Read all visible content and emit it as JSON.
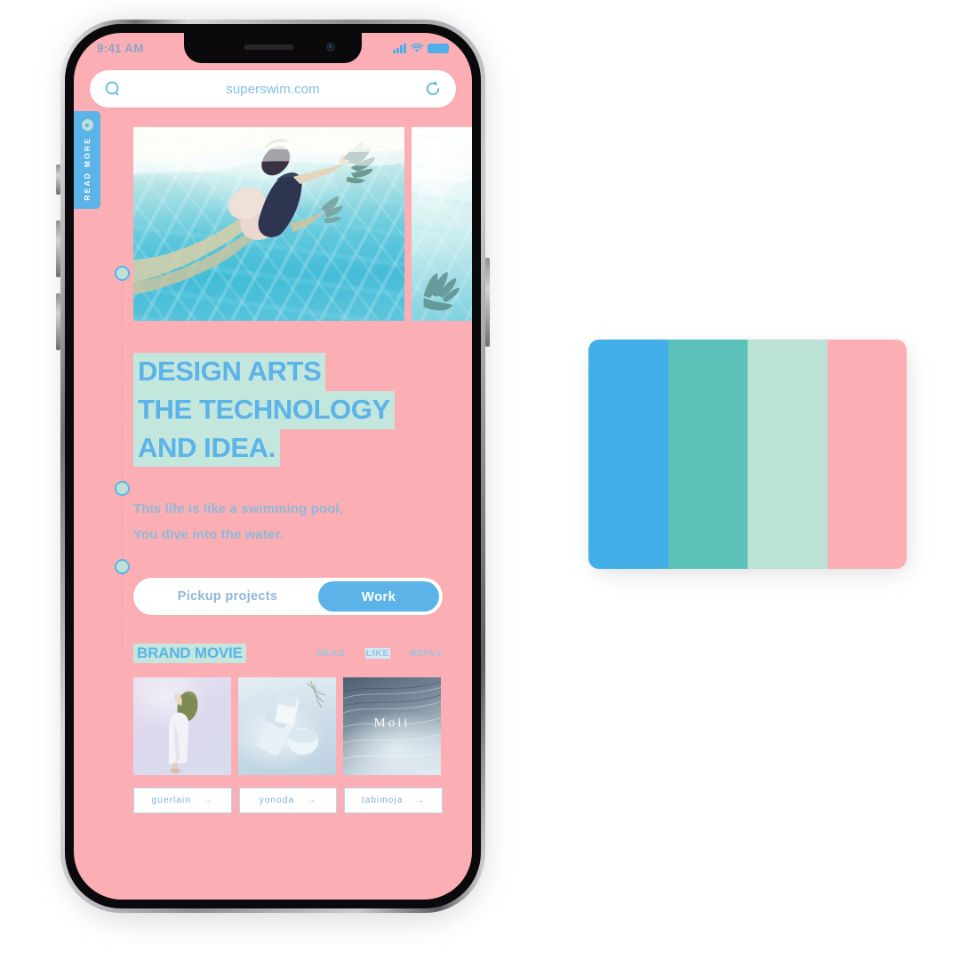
{
  "colors": {
    "page_pink": "#FBAFB5",
    "accent_blue": "#5BB3E8",
    "mint": "#C3E6DD",
    "teal": "#5CC1B8",
    "body_blue": "#8FB8D8",
    "white": "#FFFFFF"
  },
  "phone": {
    "statusbar": {
      "time": "9:41 AM",
      "signal_icon": "cellular-bars-icon",
      "wifi_icon": "wifi-icon",
      "battery_icon": "battery-icon"
    },
    "browser": {
      "search_icon": "search-icon",
      "url": "superswim.com",
      "reload_icon": "reload-icon"
    },
    "read_more_tab": {
      "label": "READ MORE",
      "icon": "circle-dot-icon"
    },
    "hero": {
      "main_image_alt": "underwater-swimmer-photo",
      "side_image_alt": "underwater-hand-photo"
    },
    "headline": {
      "line1": "DESIGN ARTS",
      "line2": "THE TECHNOLOGY",
      "line3": "AND IDEA."
    },
    "subtext": {
      "line1": "This life is like a swimming pool,",
      "line2": "You dive into the water."
    },
    "toggle": {
      "left_label": "Pickup projects",
      "right_label": "Work"
    },
    "movie_row": {
      "title": "BRAND MOVIE",
      "actions": [
        {
          "label": "READ",
          "highlighted": false
        },
        {
          "label": "LIKE",
          "highlighted": true
        },
        {
          "label": "REPLY",
          "highlighted": false
        }
      ]
    },
    "thumbnails": [
      {
        "alt": "woman-in-white-dress-photo"
      },
      {
        "alt": "cosmetic-bottles-photo"
      },
      {
        "alt": "moii-texture-photo",
        "caption": "Moii"
      }
    ],
    "tags": [
      {
        "label": "guerlain",
        "arrow": "→"
      },
      {
        "label": "yonoda",
        "arrow": "→"
      },
      {
        "label": "tabimoja",
        "arrow": "→"
      }
    ]
  },
  "palette": {
    "swatches": [
      {
        "name": "sky-blue",
        "hex": "#42AFE8",
        "width_pct": 25
      },
      {
        "name": "teal",
        "hex": "#5CC1B8",
        "width_pct": 25
      },
      {
        "name": "mint",
        "hex": "#BCE2D8",
        "width_pct": 25
      },
      {
        "name": "pink",
        "hex": "#FBAFB5",
        "width_pct": 25
      }
    ]
  }
}
